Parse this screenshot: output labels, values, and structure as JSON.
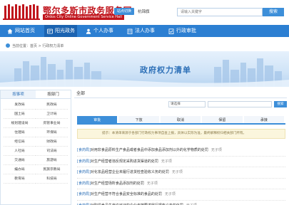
{
  "header": {
    "site_title": "鄂尔多斯市政务服务网",
    "site_subtitle": "Ordos City Online Government Service Hall",
    "region_button": "站点切换",
    "region_name": "杭锦旗",
    "search_placeholder": "请输入关键字",
    "search_button": "搜索"
  },
  "nav": {
    "items": [
      {
        "label": "网站首页",
        "icon": "home-icon"
      },
      {
        "label": "阳光政务",
        "icon": "sun-icon"
      },
      {
        "label": "个人办事",
        "icon": "person-icon"
      },
      {
        "label": "法人办事",
        "icon": "company-icon"
      },
      {
        "label": "行政审批",
        "icon": "approval-icon"
      }
    ],
    "active_index": 1
  },
  "breadcrumb": "当前位置：首页 > 行政权力清单",
  "banner": {
    "title": "政府权力清单"
  },
  "left": {
    "tabs": [
      "按事项",
      "按部门"
    ],
    "active_tab": 1,
    "depts": [
      "发改局",
      "民政局",
      "国土局",
      "卫计局",
      "规划建设局",
      "房管事业局",
      "住建局",
      "环保局",
      "经信局",
      "财政局",
      "人社局",
      "司法局",
      "交通局",
      "旅游局",
      "编办局",
      "民族宗教局",
      "教育局",
      "科技局"
    ]
  },
  "main": {
    "heading": "全部",
    "select_text": "请选择",
    "query_button": "搜索",
    "types": [
      "审批",
      "下放",
      "取消",
      "保留",
      "承接"
    ],
    "active_type": 0,
    "notice": "提示：本清单来源于各部门行政权力事项自查上报，具体以实际为准，最终解释权归相关部门所有。",
    "items": [
      {
        "tag": "[食药局]",
        "text": "对用非食品原料生产食品或者食品中添加食品添加剂以外的化学物质的处罚",
        "status": "无子项"
      },
      {
        "tag": "[食药局]",
        "text": "对生产经营者违反规定采购进货渠道的处罚",
        "status": "无子项"
      },
      {
        "tag": "[食药局]",
        "text": "对化妆品经营企业未履行进货检查验收义务的处罚",
        "status": "无子项"
      },
      {
        "tag": "[食药局]",
        "text": "对生产经营场所食品添加剂的处罚",
        "status": "无子项"
      },
      {
        "tag": "[食药局]",
        "text": "对生产经营不符合食品安全标准的食品的处罚",
        "status": "无子项"
      },
      {
        "tag": "[食药局]",
        "text": "对取得食品生产许可证的企业未按要求履行报告义务的处罚",
        "status": "无子项"
      }
    ]
  },
  "colors": {
    "brand_red": "#c0141c",
    "nav_blue": "#2c7fd2",
    "accent_blue": "#3d8fd9"
  }
}
